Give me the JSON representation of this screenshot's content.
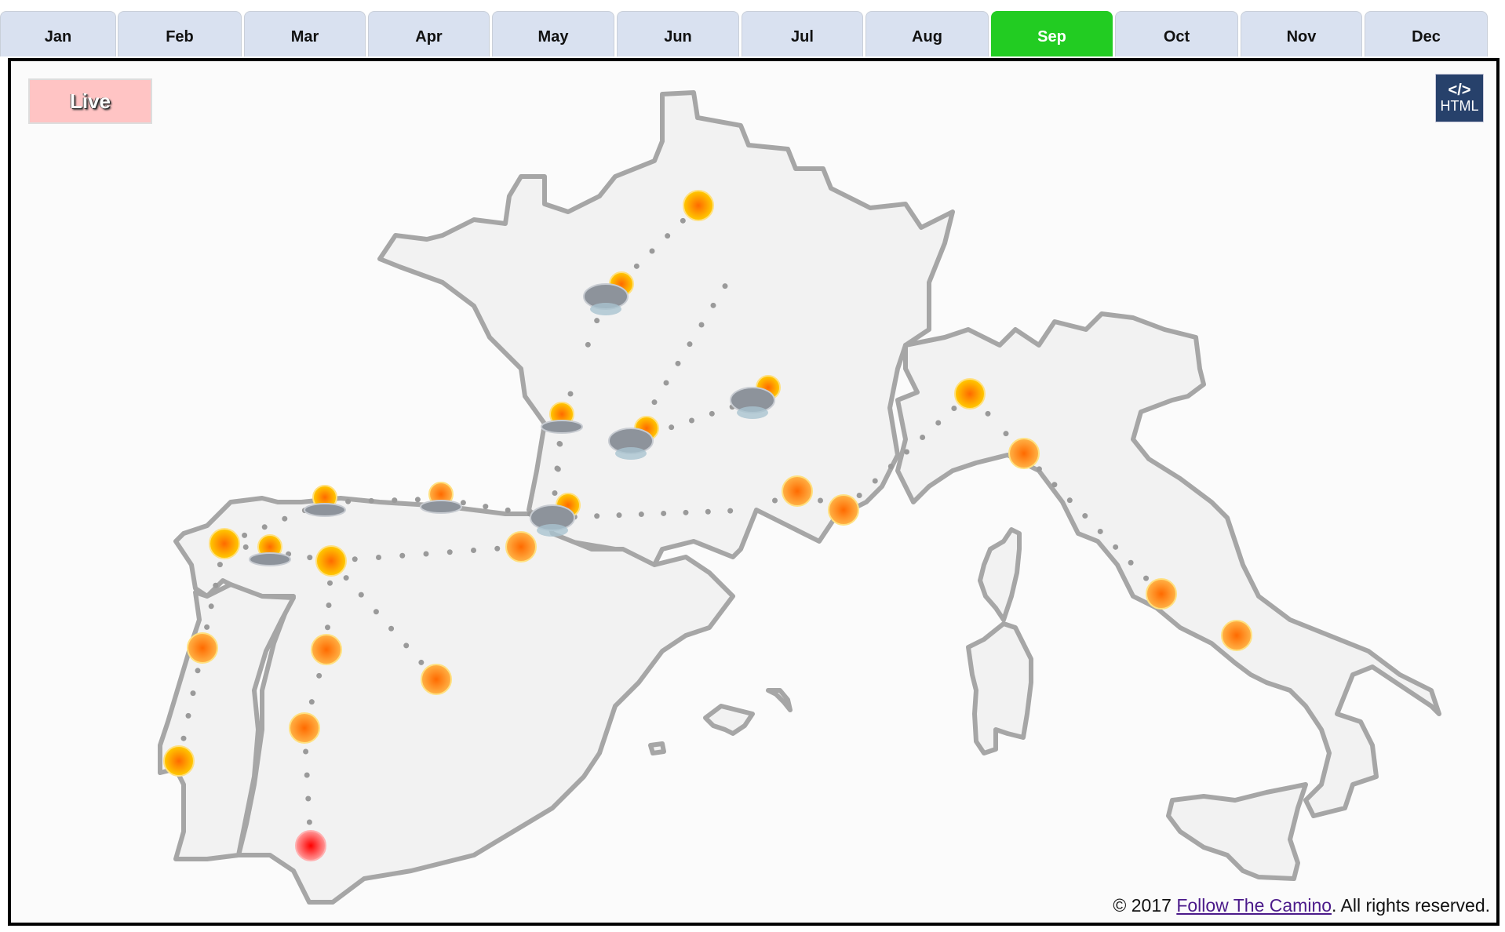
{
  "tabs": [
    {
      "label": "Jan",
      "active": false
    },
    {
      "label": "Feb",
      "active": false
    },
    {
      "label": "Mar",
      "active": false
    },
    {
      "label": "Apr",
      "active": false
    },
    {
      "label": "May",
      "active": false
    },
    {
      "label": "Jun",
      "active": false
    },
    {
      "label": "Jul",
      "active": false
    },
    {
      "label": "Aug",
      "active": false
    },
    {
      "label": "Sep",
      "active": true
    },
    {
      "label": "Oct",
      "active": false
    },
    {
      "label": "Nov",
      "active": false
    },
    {
      "label": "Dec",
      "active": false
    }
  ],
  "live_label": "Live",
  "embed_button": {
    "icon": "</>",
    "label": "HTML"
  },
  "footer": {
    "prefix": "© 2017 ",
    "link_text": "Follow The Camino",
    "suffix": ". All rights reserved."
  },
  "colors": {
    "active_tab": "#22cc22",
    "land": "#f2f2f2",
    "border": "#a6a6a6",
    "route_dot": "#9a9a9a",
    "sun_warm": "#ffcc00",
    "sun_hot": "#ff6a00",
    "sun_very_hot": "#ff0000"
  },
  "map": {
    "regions": [
      "France",
      "Spain",
      "Portugal",
      "Italy",
      "Corsica",
      "Sardinia",
      "Sicily",
      "Balearic Islands"
    ],
    "markers": [
      {
        "type": "sun",
        "heat": "warm"
      },
      {
        "type": "cloud-rain-sun",
        "heat": "warm"
      },
      {
        "type": "sun-cloud",
        "heat": "warm"
      },
      {
        "type": "cloud-rain-sun",
        "heat": "warm"
      },
      {
        "type": "cloud-rain-sun",
        "heat": "warm"
      },
      {
        "type": "cloud-rain-sun",
        "heat": "warm"
      },
      {
        "type": "sun-cloud",
        "heat": "warm"
      },
      {
        "type": "sun-cloud",
        "heat": "hot"
      },
      {
        "type": "sun",
        "heat": "warm"
      },
      {
        "type": "sun-cloud",
        "heat": "warm"
      },
      {
        "type": "sun",
        "heat": "warm"
      },
      {
        "type": "sun",
        "heat": "hot"
      },
      {
        "type": "sun",
        "heat": "warm"
      },
      {
        "type": "sun",
        "heat": "hot"
      },
      {
        "type": "sun",
        "heat": "hot"
      },
      {
        "type": "sun",
        "heat": "hot"
      },
      {
        "type": "sun",
        "heat": "hot"
      },
      {
        "type": "sun",
        "heat": "very-hot"
      },
      {
        "type": "sun",
        "heat": "hot"
      },
      {
        "type": "sun",
        "heat": "hot"
      },
      {
        "type": "sun",
        "heat": "warm"
      },
      {
        "type": "sun",
        "heat": "hot"
      },
      {
        "type": "sun",
        "heat": "hot"
      },
      {
        "type": "sun",
        "heat": "hot"
      }
    ]
  }
}
